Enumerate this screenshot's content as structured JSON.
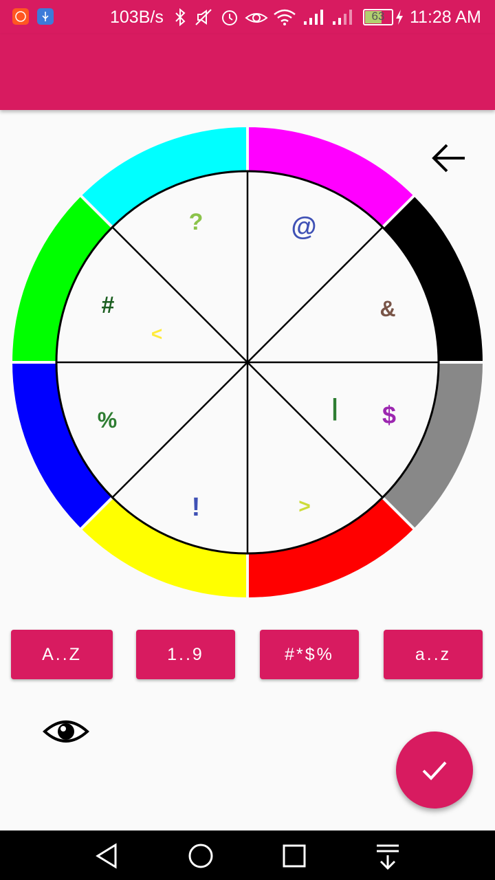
{
  "status_bar": {
    "speed": "103B/s",
    "battery": "63",
    "time": "11:28 AM",
    "icons": [
      "mi-app-icon",
      "usb-icon",
      "bluetooth-icon",
      "mute-icon",
      "alarm-icon",
      "eye-comfort-icon",
      "wifi-icon",
      "signal-icon",
      "signal-icon",
      "battery-icon",
      "charging-icon"
    ]
  },
  "wheel": {
    "ring_colors": [
      "#ff00ff",
      "#000000",
      "#888888",
      "#ff0000",
      "#ffff00",
      "#0000ff",
      "#00ff00",
      "#00ffff"
    ],
    "symbols": [
      {
        "char": "@",
        "color": "#3f51b5"
      },
      {
        "char": "&",
        "color": "#795548"
      },
      {
        "char": "|",
        "color": "#2e7d32"
      },
      {
        "char": "$",
        "color": "#9c27b0"
      },
      {
        "char": ">",
        "color": "#cddc39"
      },
      {
        "char": "!",
        "color": "#3f51b5"
      },
      {
        "char": "%",
        "color": "#2e7d32"
      },
      {
        "char": "#",
        "color": "#1b5e20"
      },
      {
        "char": "<",
        "color": "#ffeb3b"
      },
      {
        "char": "?",
        "color": "#8bc34a"
      }
    ]
  },
  "buttons": {
    "uppercase": "A..Z",
    "digits": "1..9",
    "symbols": "#*$%",
    "lowercase": "a..z"
  },
  "icons": {
    "back": "back-arrow-icon",
    "visibility": "eye-icon",
    "confirm": "check-icon"
  },
  "colors": {
    "accent": "#d81b60",
    "background": "#fafafa"
  }
}
